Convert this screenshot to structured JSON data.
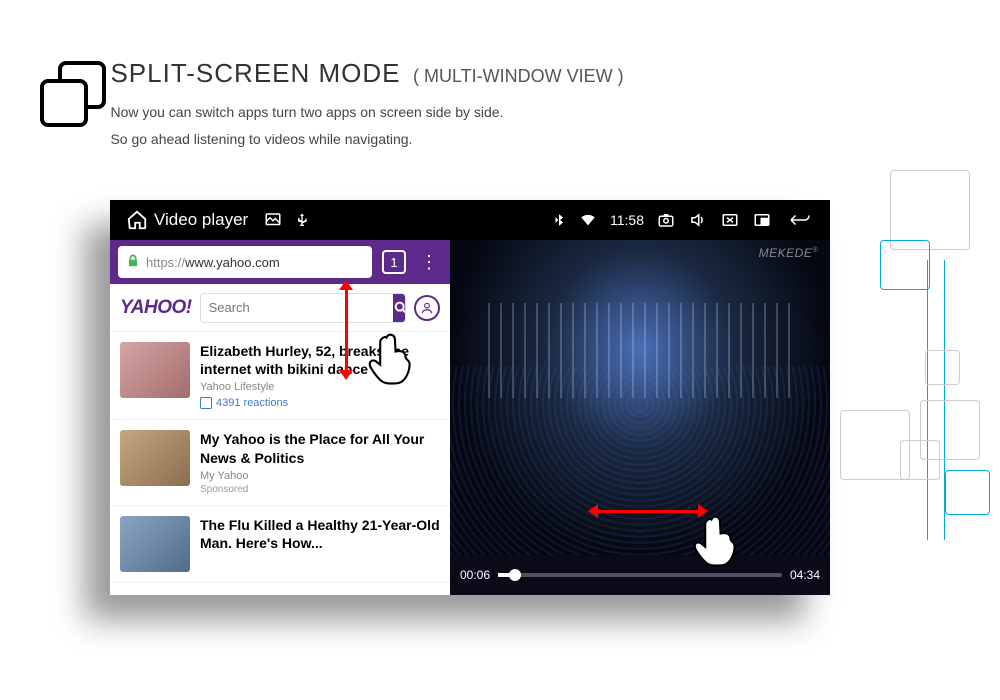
{
  "heading": {
    "title": "SPLIT-SCREEN MODE",
    "subtitle": "( MULTI-WINDOW VIEW )",
    "line1": "Now you can switch apps turn two apps on screen side by side.",
    "line2": "So go ahead listening to videos while navigating."
  },
  "statusbar": {
    "app_title": "Video player",
    "time": "11:58"
  },
  "brand": "MEKEDE",
  "browser": {
    "url_prefix": "https://",
    "url_domain": "www.yahoo.com",
    "tab_count": "1",
    "search_placeholder": "Search"
  },
  "feed": [
    {
      "title": "Elizabeth Hurley, 52, breaks the internet with bikini dance",
      "source": "Yahoo Lifestyle",
      "reactions": "4391 reactions"
    },
    {
      "title": "My Yahoo is the Place for All Your News & Politics",
      "source": "My Yahoo",
      "sponsored": "Sponsored"
    },
    {
      "title": "The Flu Killed a Healthy 21-Year-Old Man. Here's How...",
      "source": ""
    }
  ],
  "video": {
    "current": "00:06",
    "duration": "04:34"
  }
}
